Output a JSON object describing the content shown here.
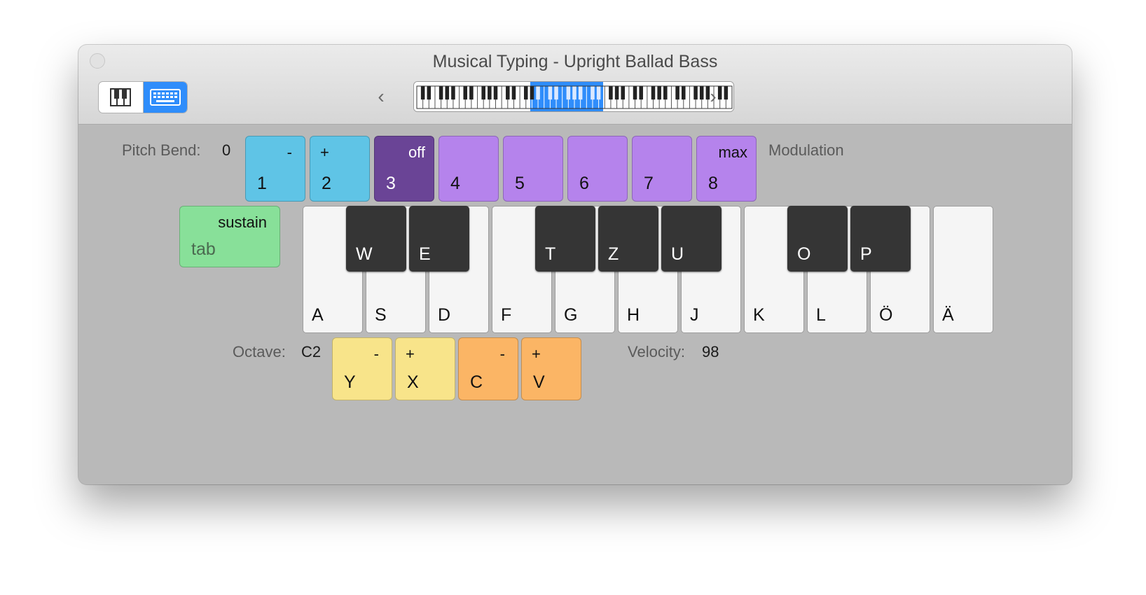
{
  "window": {
    "title": "Musical Typing - Upright Ballad Bass",
    "view_modes": [
      {
        "name": "piano",
        "icon": "piano-keys-icon",
        "active": false
      },
      {
        "name": "keyboard",
        "icon": "computer-keyboard-icon",
        "active": true
      }
    ],
    "nav": {
      "prev_icon": "chevron-left-icon",
      "next_icon": "chevron-right-icon"
    }
  },
  "pitch_bend": {
    "label": "Pitch Bend:",
    "value": "0",
    "keys": [
      {
        "key": "1",
        "sub": "-"
      },
      {
        "key": "2",
        "sub": "+"
      }
    ]
  },
  "modulation": {
    "label": "Modulation",
    "keys": [
      {
        "key": "3",
        "sub": "off"
      },
      {
        "key": "4",
        "sub": ""
      },
      {
        "key": "5",
        "sub": ""
      },
      {
        "key": "6",
        "sub": ""
      },
      {
        "key": "7",
        "sub": ""
      },
      {
        "key": "8",
        "sub": "max"
      }
    ]
  },
  "sustain": {
    "key": "tab",
    "sub": "sustain"
  },
  "piano": {
    "white_keys": [
      "A",
      "S",
      "D",
      "F",
      "G",
      "H",
      "J",
      "K",
      "L",
      "Ö",
      "Ä"
    ],
    "black_keys": [
      "W",
      "E",
      "T",
      "Z",
      "U",
      "O",
      "P"
    ]
  },
  "octave": {
    "label": "Octave:",
    "value": "C2",
    "keys": [
      {
        "key": "Y",
        "sub": "-"
      },
      {
        "key": "X",
        "sub": "+"
      }
    ]
  },
  "velocity": {
    "label": "Velocity:",
    "value": "98",
    "keys": [
      {
        "key": "C",
        "sub": "-"
      },
      {
        "key": "V",
        "sub": "+"
      }
    ]
  },
  "colors": {
    "accent": "#2f8dfb",
    "pitch_bend": "#5fc4e6",
    "modulation_off": "#6a4496",
    "modulation": "#b583ec",
    "sustain": "#88e099",
    "octave": "#f8e48a",
    "velocity": "#fbb565"
  }
}
